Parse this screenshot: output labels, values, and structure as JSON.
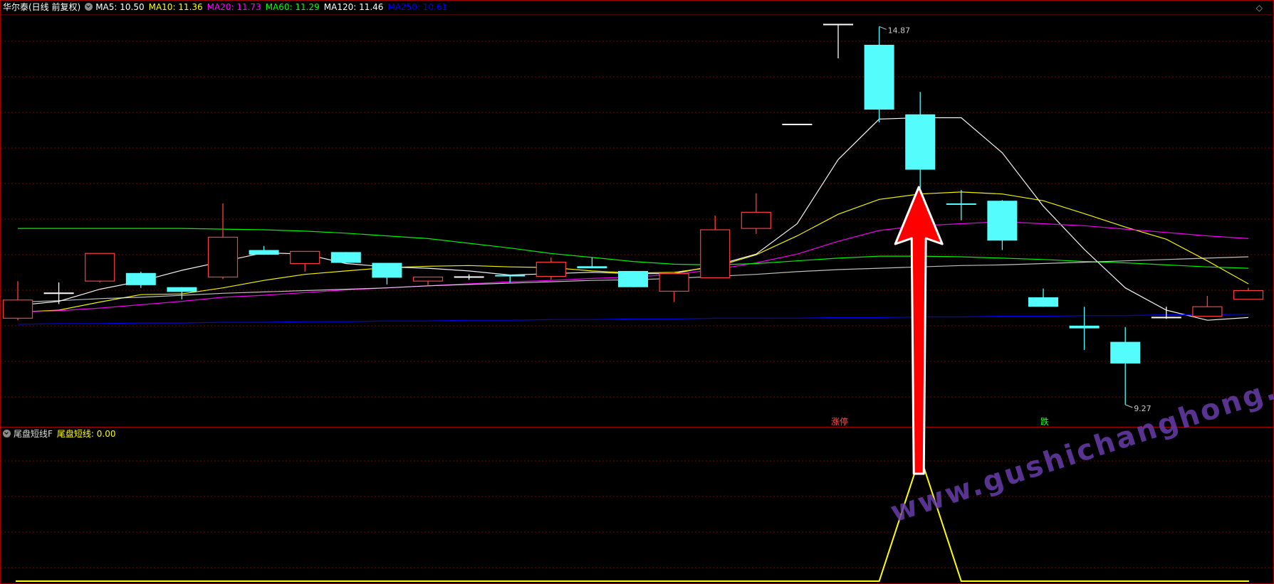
{
  "header": {
    "title": "华尔泰(日线 前复权)",
    "ma": [
      {
        "label": "MA5: 10.50",
        "color": "#ffffff"
      },
      {
        "label": "MA10: 11.36",
        "color": "#ffff00"
      },
      {
        "label": "MA20: 11.73",
        "color": "#ff00ff"
      },
      {
        "label": "MA60: 11.29",
        "color": "#00ff00"
      },
      {
        "label": "MA120: 11.46",
        "color": "#ffffff"
      },
      {
        "label": "MA250: 10.61",
        "color": "#0000ff"
      }
    ]
  },
  "lower": {
    "title": "尾盘短线F",
    "value_label": "尾盘短线: 0.00"
  },
  "watermark": "www.gushichanghong.com",
  "chart_data": [
    {
      "type": "candlestick",
      "title": "华尔泰(日线 前复权)",
      "price_min_visible": 9.27,
      "price_max_visible": 14.87,
      "ylim": [
        9.1,
        15.0
      ],
      "colors": {
        "up": "#ff3c3c",
        "down": "#54fcfc",
        "flat": "#ffffff"
      },
      "candles": [
        {
          "o": 10.55,
          "c": 10.82,
          "h": 11.1,
          "l": 10.52
        },
        {
          "o": 10.92,
          "c": 10.92,
          "h": 11.08,
          "l": 10.76
        },
        {
          "o": 11.1,
          "c": 11.51,
          "h": 11.51,
          "l": 11.08
        },
        {
          "o": 11.22,
          "c": 11.04,
          "h": 11.24,
          "l": 11.0
        },
        {
          "o": 11.01,
          "c": 10.94,
          "h": 11.01,
          "l": 10.83
        },
        {
          "o": 11.16,
          "c": 11.75,
          "h": 12.25,
          "l": 11.13
        },
        {
          "o": 11.56,
          "c": 11.49,
          "h": 11.62,
          "l": 11.49
        },
        {
          "o": 11.36,
          "c": 11.54,
          "h": 11.54,
          "l": 11.24
        },
        {
          "o": 11.53,
          "c": 11.37,
          "h": 11.53,
          "l": 11.37
        },
        {
          "o": 11.37,
          "c": 11.15,
          "h": 11.37,
          "l": 11.05
        },
        {
          "o": 11.1,
          "c": 11.16,
          "h": 11.16,
          "l": 11.04
        },
        {
          "o": 11.16,
          "c": 11.16,
          "h": 11.2,
          "l": 11.12
        },
        {
          "o": 11.18,
          "c": 11.16,
          "h": 11.18,
          "l": 11.08
        },
        {
          "o": 11.17,
          "c": 11.38,
          "h": 11.45,
          "l": 11.12
        },
        {
          "o": 11.32,
          "c": 11.29,
          "h": 11.45,
          "l": 11.29
        },
        {
          "o": 11.25,
          "c": 11.01,
          "h": 11.25,
          "l": 11.01
        },
        {
          "o": 10.95,
          "c": 11.21,
          "h": 11.21,
          "l": 10.79
        },
        {
          "o": 11.15,
          "c": 11.86,
          "h": 12.07,
          "l": 11.15
        },
        {
          "o": 11.88,
          "c": 12.12,
          "h": 12.4,
          "l": 11.8
        },
        {
          "o": 13.42,
          "c": 13.42,
          "h": 13.42,
          "l": 13.42
        },
        {
          "o": 14.9,
          "c": 14.9,
          "h": 14.9,
          "l": 14.4
        },
        {
          "o": 14.6,
          "c": 13.64,
          "h": 14.87,
          "l": 13.45
        },
        {
          "o": 13.57,
          "c": 12.75,
          "h": 13.9,
          "l": 12.45
        },
        {
          "o": 12.24,
          "c": 12.24,
          "h": 12.45,
          "l": 12.0
        },
        {
          "o": 12.29,
          "c": 11.7,
          "h": 12.3,
          "l": 11.56
        },
        {
          "o": 10.86,
          "c": 10.72,
          "h": 10.99,
          "l": 10.72
        },
        {
          "o": 10.44,
          "c": 10.4,
          "h": 10.72,
          "l": 10.08
        },
        {
          "o": 10.2,
          "c": 9.88,
          "h": 10.42,
          "l": 9.27
        },
        {
          "o": 10.56,
          "c": 10.56,
          "h": 10.72,
          "l": 10.54
        },
        {
          "o": 10.58,
          "c": 10.72,
          "h": 10.88,
          "l": 10.58
        },
        {
          "o": 10.83,
          "c": 10.96,
          "h": 11.0,
          "l": 10.83
        }
      ],
      "moving_averages": [
        {
          "name": "MA5",
          "color": "#ffffff",
          "values": [
            10.74,
            10.8,
            10.98,
            11.1,
            11.26,
            11.39,
            11.52,
            11.5,
            11.36,
            11.31,
            11.29,
            11.25,
            11.19,
            11.21,
            11.23,
            11.21,
            11.21,
            11.33,
            11.5,
            11.95,
            12.9,
            13.5,
            13.52,
            13.52,
            13.0,
            12.21,
            11.57,
            11.0,
            10.67,
            10.52,
            10.56
          ]
        },
        {
          "name": "MA10",
          "color": "#ffff00",
          "values": [
            10.64,
            10.67,
            10.79,
            10.9,
            10.91,
            11.0,
            11.11,
            11.2,
            11.25,
            11.3,
            11.32,
            11.33,
            11.31,
            11.3,
            11.25,
            11.22,
            11.23,
            11.31,
            11.49,
            11.77,
            12.09,
            12.31,
            12.39,
            12.42,
            12.39,
            12.29,
            12.1,
            11.9,
            11.72,
            11.4,
            11.06
          ]
        },
        {
          "name": "MA20",
          "color": "#ff00ff",
          "values": [
            10.64,
            10.66,
            10.7,
            10.75,
            10.8,
            10.86,
            10.89,
            10.93,
            10.97,
            11.0,
            11.03,
            11.06,
            11.09,
            11.11,
            11.14,
            11.16,
            11.2,
            11.27,
            11.37,
            11.5,
            11.69,
            11.85,
            11.92,
            11.95,
            11.98,
            11.95,
            11.92,
            11.87,
            11.82,
            11.77,
            11.73
          ]
        },
        {
          "name": "MA60",
          "color": "#00ff00",
          "values": [
            11.88,
            11.88,
            11.88,
            11.88,
            11.88,
            11.87,
            11.86,
            11.84,
            11.81,
            11.77,
            11.73,
            11.66,
            11.59,
            11.51,
            11.45,
            11.39,
            11.35,
            11.34,
            11.36,
            11.4,
            11.44,
            11.47,
            11.47,
            11.46,
            11.44,
            11.42,
            11.39,
            11.37,
            11.34,
            11.31,
            11.29
          ]
        },
        {
          "name": "MA120",
          "color": "#ffffff",
          "values": [
            10.79,
            10.81,
            10.84,
            10.86,
            10.89,
            10.92,
            10.94,
            10.96,
            10.98,
            11.0,
            11.03,
            11.05,
            11.07,
            11.09,
            11.11,
            11.12,
            11.14,
            11.17,
            11.2,
            11.24,
            11.27,
            11.29,
            11.31,
            11.33,
            11.34,
            11.36,
            11.38,
            11.4,
            11.42,
            11.44,
            11.46
          ]
        },
        {
          "name": "MA250",
          "color": "#0000ff",
          "values": [
            10.46,
            10.47,
            10.47,
            10.48,
            10.48,
            10.49,
            10.49,
            10.5,
            10.5,
            10.51,
            10.51,
            10.52,
            10.52,
            10.53,
            10.53,
            10.54,
            10.54,
            10.55,
            10.55,
            10.55,
            10.56,
            10.56,
            10.57,
            10.57,
            10.58,
            10.58,
            10.59,
            10.59,
            10.6,
            10.6,
            10.61
          ]
        }
      ],
      "annotations": [
        {
          "text": "14.87",
          "index": 21,
          "price": 14.87,
          "color": "#c8c8c8"
        },
        {
          "text": "9.27",
          "index": 27,
          "price": 9.27,
          "color": "#c8c8c8"
        },
        {
          "text": "涨停",
          "index": 20,
          "color": "#ff5050"
        },
        {
          "text": "跌",
          "index": 25,
          "color": "#20ff20"
        }
      ],
      "arrow": {
        "index": 22,
        "color": "#ff0000"
      }
    },
    {
      "type": "line",
      "title": "尾盘短线F",
      "series": [
        {
          "name": "尾盘短线",
          "color": "#ffff00",
          "values": [
            0,
            0,
            0,
            0,
            0,
            0,
            0,
            0,
            0,
            0,
            0,
            0,
            0,
            0,
            0,
            0,
            0,
            0,
            0,
            0,
            0,
            0,
            1,
            0,
            0,
            0,
            0,
            0,
            0,
            0,
            0
          ]
        }
      ],
      "ylim": [
        0,
        1.15
      ]
    }
  ]
}
